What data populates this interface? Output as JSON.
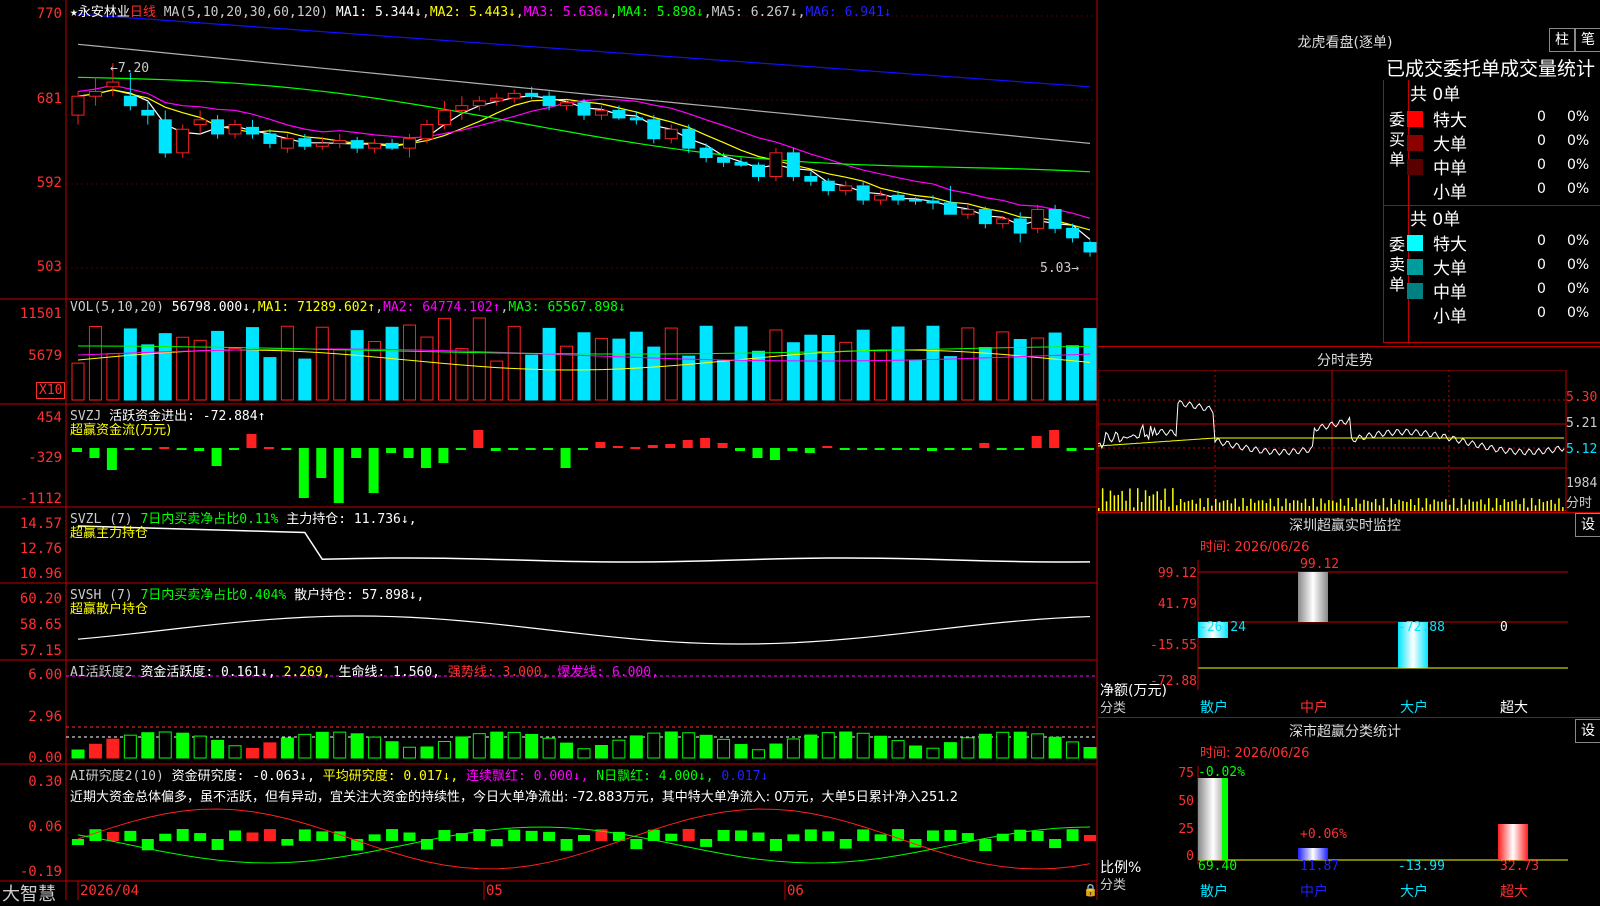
{
  "colors": {
    "up": "#ff2020",
    "down": "#00e5ff",
    "grid": "#c00000",
    "ma1": "#ffffff",
    "ma2": "#ffff00",
    "ma3": "#ff00ff",
    "ma4": "#00ff00",
    "ma5": "#b0b0b0",
    "ma6": "#1010ff"
  },
  "main": {
    "ma_title": {
      "star": "★",
      "name": "永安林业",
      "period": "日线",
      "params": "MA(5,10,20,30,60,120)",
      "ma1": "MA1: 5.344↓",
      "ma2": "MA2: 5.443↓",
      "ma3": "MA3: 5.636↓",
      "ma4": "MA4: 5.898↓",
      "ma5": "MA5: 6.267↓",
      "ma6": "MA6: 6.941↓"
    },
    "y_labels": [
      "770",
      "681",
      "592",
      "503"
    ],
    "high_label": "←7.20",
    "low_label": "5.03→"
  },
  "vol": {
    "title": {
      "name": "VOL(5,10,20)",
      "v": "56798.000↓",
      "ma1": "MA1: 71289.602↑",
      "ma2": "MA2: 64774.102↑",
      "ma3": "MA3: 65567.898↓"
    },
    "y_labels": [
      "11501",
      "5679"
    ],
    "unit": "X10"
  },
  "svzj": {
    "title": {
      "name": "SVZJ",
      "text": "活跃资金进出: -72.884↑",
      "sub": "超赢资金流(万元)"
    },
    "y_labels": [
      "454",
      "-329",
      "-1112"
    ]
  },
  "svzl": {
    "title": {
      "name": "SVZL (7)",
      "a": "7日内买卖净占比0.11%",
      "b": "主力持仓: 11.736↓,",
      "sub": "超赢主力持仓"
    },
    "y_labels": [
      "14.57",
      "12.76",
      "10.96"
    ]
  },
  "svsh": {
    "title": {
      "name": "SVSH (7)",
      "a": "7日内买卖净占比0.404%",
      "b": "散户持仓: 57.898↓,",
      "sub": "超赢散户持仓"
    },
    "y_labels": [
      "60.20",
      "58.65",
      "57.15"
    ]
  },
  "ai2": {
    "title": {
      "name": "AI活跃度2",
      "a": "资金活跃度: 0.161↓,",
      "b": "2.269,",
      "c": "生命线: 1.560,",
      "d": "强势线: 3.000,",
      "e": "爆发线: 6.000,"
    },
    "y_labels": [
      "6.00",
      "2.96",
      "0.00"
    ]
  },
  "ai3": {
    "title": {
      "name": "AI研究度2(10)",
      "a": "资金研究度: -0.063↓,",
      "b": "平均研究度: 0.017↓,",
      "c": "连续飘红: 0.000↓,",
      "d": "N日飘红: 4.000↓,",
      "e": "0.017↓"
    },
    "comment": "近期大资金总体偏多，虽不活跃，但有异动，宜关注大资金的持续性，今日大单净流出: -72.883万元，其中特大单净流入: 0万元，大单5日累计净入251.2",
    "y_labels": [
      "0.30",
      "0.06",
      "-0.19"
    ]
  },
  "xaxis": {
    "labels": [
      "2026/04",
      "05",
      "06"
    ],
    "brand": "大智慧"
  },
  "right": {
    "lhb": {
      "title": "龙虎看盘(逐单)",
      "btn1": "柱",
      "btn2": "笔",
      "subtitle": "已成交委托单成交量统计",
      "buy": {
        "side": "委买单",
        "total": "共 0单",
        "rows": [
          {
            "name": "特大",
            "val": "0",
            "pct": "0%"
          },
          {
            "name": "大单",
            "val": "0",
            "pct": "0%"
          },
          {
            "name": "中单",
            "val": "0",
            "pct": "0%"
          },
          {
            "name": "小单",
            "val": "0",
            "pct": "0%"
          }
        ]
      },
      "sell": {
        "side": "委卖单",
        "total": "共 0单",
        "rows": [
          {
            "name": "特大",
            "val": "0",
            "pct": "0%"
          },
          {
            "name": "大单",
            "val": "0",
            "pct": "0%"
          },
          {
            "name": "中单",
            "val": "0",
            "pct": "0%"
          },
          {
            "name": "小单",
            "val": "0",
            "pct": "0%"
          }
        ]
      }
    },
    "fenshi": {
      "title": "分时走势",
      "y_labels": [
        "5.30",
        "5.21",
        "5.12"
      ],
      "vol_label": "1984",
      "vol_unit": "分时"
    },
    "monitor": {
      "title": "深圳超赢实时监控",
      "btn": "设",
      "time": "时间: 2026/06/26",
      "y_labels": [
        "99.12",
        "41.79",
        "-15.55",
        "-72.88"
      ],
      "unit": "净额(万元)",
      "cat_label": "分类",
      "bars": [
        {
          "name": "散户",
          "value": "-26.24"
        },
        {
          "name": "中户",
          "value": "99.12"
        },
        {
          "name": "大户",
          "value": "-72.88"
        },
        {
          "name": "超大",
          "value": "0"
        }
      ]
    },
    "stats": {
      "title": "深市超赢分类统计",
      "btn": "设",
      "time": "时间: 2026/06/26",
      "y_labels": [
        "75",
        "50",
        "25",
        "0"
      ],
      "unit": "比例%",
      "cat_label": "分类",
      "bars": [
        {
          "name": "散户",
          "value": "69.40",
          "delta": "-0.02%"
        },
        {
          "name": "中户",
          "value": "11.87",
          "delta": "+0.06%"
        },
        {
          "name": "大户",
          "value": "-13.99",
          "delta": ""
        },
        {
          "name": "超大",
          "value": "32.73",
          "delta": ""
        }
      ]
    }
  },
  "chart_data": {
    "type": "candlestick",
    "title": "永安林业 日线",
    "ylim": [
      5.03,
      7.7
    ],
    "series": [
      {
        "name": "price",
        "ohlc": [
          [
            6.65,
            6.9,
            6.55,
            6.85
          ],
          [
            6.85,
            7.05,
            6.75,
            6.9
          ],
          [
            6.95,
            7.2,
            6.85,
            7.0
          ],
          [
            6.85,
            7.1,
            6.7,
            6.75
          ],
          [
            6.7,
            6.8,
            6.55,
            6.65
          ],
          [
            6.6,
            6.7,
            6.2,
            6.25
          ],
          [
            6.25,
            6.55,
            6.2,
            6.5
          ],
          [
            6.55,
            6.7,
            6.45,
            6.6
          ],
          [
            6.6,
            6.65,
            6.4,
            6.45
          ],
          [
            6.45,
            6.6,
            6.4,
            6.55
          ],
          [
            6.52,
            6.6,
            6.4,
            6.45
          ],
          [
            6.45,
            6.5,
            6.3,
            6.35
          ],
          [
            6.3,
            6.45,
            6.25,
            6.4
          ],
          [
            6.4,
            6.45,
            6.28,
            6.32
          ],
          [
            6.32,
            6.42,
            6.28,
            6.35
          ],
          [
            6.35,
            6.45,
            6.3,
            6.38
          ],
          [
            6.38,
            6.42,
            6.25,
            6.3
          ],
          [
            6.3,
            6.4,
            6.25,
            6.35
          ],
          [
            6.35,
            6.4,
            6.28,
            6.3
          ],
          [
            6.3,
            6.45,
            6.2,
            6.4
          ],
          [
            6.4,
            6.6,
            6.35,
            6.55
          ],
          [
            6.55,
            6.8,
            6.5,
            6.7
          ],
          [
            6.7,
            6.85,
            6.6,
            6.75
          ],
          [
            6.75,
            6.85,
            6.7,
            6.8
          ],
          [
            6.8,
            6.88,
            6.75,
            6.83
          ],
          [
            6.83,
            6.92,
            6.78,
            6.88
          ],
          [
            6.88,
            6.95,
            6.82,
            6.85
          ],
          [
            6.85,
            6.9,
            6.7,
            6.75
          ],
          [
            6.75,
            6.8,
            6.7,
            6.78
          ],
          [
            6.78,
            6.82,
            6.6,
            6.65
          ],
          [
            6.65,
            6.75,
            6.6,
            6.7
          ],
          [
            6.7,
            6.75,
            6.6,
            6.62
          ],
          [
            6.62,
            6.68,
            6.55,
            6.6
          ],
          [
            6.6,
            6.65,
            6.35,
            6.4
          ],
          [
            6.4,
            6.55,
            6.35,
            6.5
          ],
          [
            6.5,
            6.55,
            6.25,
            6.3
          ],
          [
            6.3,
            6.35,
            6.15,
            6.2
          ],
          [
            6.2,
            6.25,
            6.1,
            6.15
          ],
          [
            6.15,
            6.2,
            6.1,
            6.12
          ],
          [
            6.12,
            6.15,
            5.95,
            6.0
          ],
          [
            6.0,
            6.3,
            5.95,
            6.25
          ],
          [
            6.25,
            6.3,
            5.95,
            6.0
          ],
          [
            6.0,
            6.05,
            5.9,
            5.95
          ],
          [
            5.95,
            5.98,
            5.8,
            5.85
          ],
          [
            5.85,
            5.95,
            5.8,
            5.9
          ],
          [
            5.9,
            5.95,
            5.7,
            5.75
          ],
          [
            5.75,
            5.85,
            5.7,
            5.8
          ],
          [
            5.8,
            5.85,
            5.7,
            5.75
          ],
          [
            5.75,
            5.78,
            5.7,
            5.74
          ],
          [
            5.74,
            5.8,
            5.65,
            5.72
          ],
          [
            5.72,
            5.9,
            5.65,
            5.6
          ],
          [
            5.6,
            5.7,
            5.55,
            5.65
          ],
          [
            5.65,
            5.68,
            5.45,
            5.5
          ],
          [
            5.5,
            5.58,
            5.45,
            5.55
          ],
          [
            5.55,
            5.62,
            5.3,
            5.4
          ],
          [
            5.45,
            5.7,
            5.4,
            5.65
          ],
          [
            5.65,
            5.7,
            5.4,
            5.45
          ],
          [
            5.45,
            5.5,
            5.3,
            5.35
          ],
          [
            5.3,
            5.32,
            5.15,
            5.2
          ]
        ]
      }
    ]
  }
}
